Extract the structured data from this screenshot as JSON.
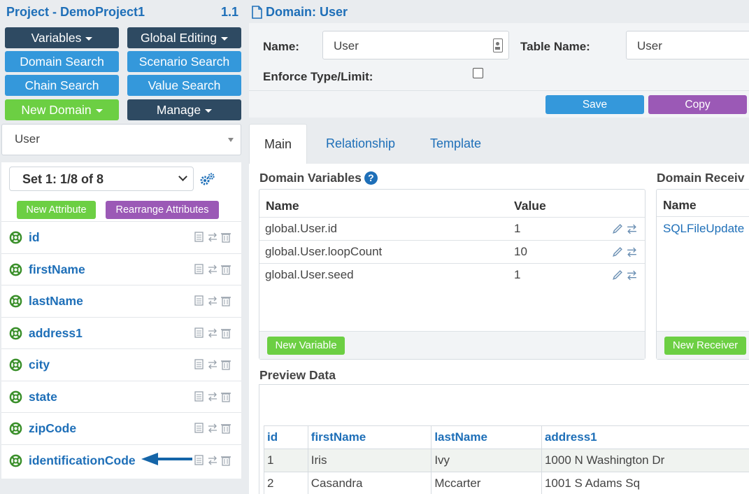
{
  "sidebar": {
    "project_title": "Project - DemoProject1",
    "project_version": "1.1",
    "buttons": {
      "variables": "Variables",
      "global_editing": "Global Editing",
      "domain_search": "Domain Search",
      "scenario_search": "Scenario Search",
      "chain_search": "Chain Search",
      "value_search": "Value Search",
      "new_domain": "New Domain",
      "manage": "Manage"
    },
    "domain_select": "User",
    "set_select": "Set 1: 1/8 of 8",
    "new_attribute": "New Attribute",
    "rearrange_attributes": "Rearrange Attributes",
    "attributes": [
      "id",
      "firstName",
      "lastName",
      "address1",
      "city",
      "state",
      "zipCode",
      "identificationCode"
    ]
  },
  "main": {
    "domain_title": "Domain: User",
    "form": {
      "name_label": "Name:",
      "name_value": "User",
      "table_name_label": "Table Name:",
      "table_name_value": "User",
      "enforce_label": "Enforce Type/Limit:",
      "enforce_checked": false,
      "save": "Save",
      "copy": "Copy"
    },
    "tabs": [
      "Main",
      "Relationship",
      "Template"
    ],
    "active_tab": "Main",
    "domain_variables": {
      "title": "Domain Variables",
      "col_name": "Name",
      "col_value": "Value",
      "rows": [
        {
          "name": "global.User.id",
          "value": "1"
        },
        {
          "name": "global.User.loopCount",
          "value": "10"
        },
        {
          "name": "global.User.seed",
          "value": "1"
        }
      ],
      "new_button": "New Variable"
    },
    "domain_receivers": {
      "title": "Domain Receiv",
      "col_name": "Name",
      "rows": [
        "SQLFileUpdate"
      ],
      "new_button": "New Receiver"
    },
    "preview": {
      "title": "Preview Data",
      "columns": [
        "id",
        "firstName",
        "lastName",
        "address1"
      ],
      "rows": [
        [
          "1",
          "Iris",
          "Ivy",
          "1000 N Washington Dr"
        ],
        [
          "2",
          "Casandra",
          "Mccarter",
          "1001 S Adams Sq"
        ]
      ]
    }
  },
  "colors": {
    "brand_blue": "#1e6fb8",
    "button_blue": "#3498db",
    "button_dark": "#2e4a62",
    "button_green": "#6ccf43",
    "button_purple": "#9b59b6"
  }
}
